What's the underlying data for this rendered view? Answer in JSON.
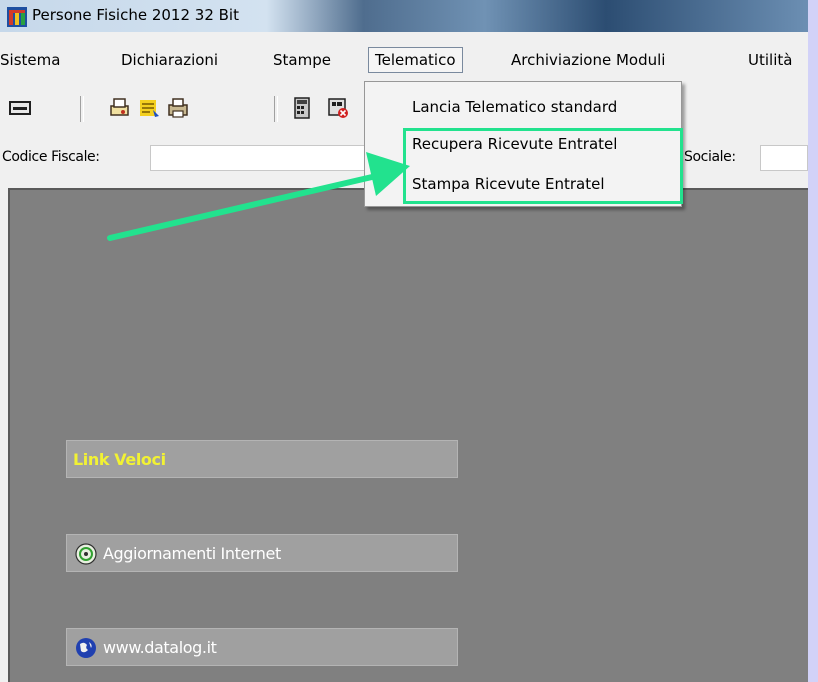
{
  "window": {
    "title": "Persone Fisiche 2012 32 Bit"
  },
  "menubar": {
    "items": [
      {
        "label": "Sistema"
      },
      {
        "label": "Dichiarazioni"
      },
      {
        "label": "Stampe"
      },
      {
        "label": "Telematico",
        "active": true
      },
      {
        "label": "Archiviazione Moduli"
      },
      {
        "label": "Utilità"
      }
    ]
  },
  "toolbar": {
    "icons": [
      "keyboard-icon",
      "print-preview-icon",
      "print-list-icon",
      "printer-icon",
      "calculator-icon",
      "form-delete-icon"
    ]
  },
  "fields": {
    "codice_fiscale_label": "Codice Fiscale:",
    "codice_fiscale_value": "",
    "ragione_sociale_label_partial": "Sociale:",
    "ragione_sociale_value": ""
  },
  "dropdown": {
    "items": [
      {
        "label": "Lancia Telematico standard"
      },
      {
        "label": "Recupera Ricevute Entratel"
      },
      {
        "label": "Stampa Ricevute Entratel"
      }
    ]
  },
  "panels": {
    "link_veloci": "Link Veloci",
    "aggiornamenti": "Aggiornamenti Internet",
    "website": "www.datalog.it"
  },
  "colors": {
    "highlight": "#22e28e",
    "arrow": "#22e28e",
    "link_veloci_text": "#f2f233",
    "main_bg": "#808080"
  }
}
